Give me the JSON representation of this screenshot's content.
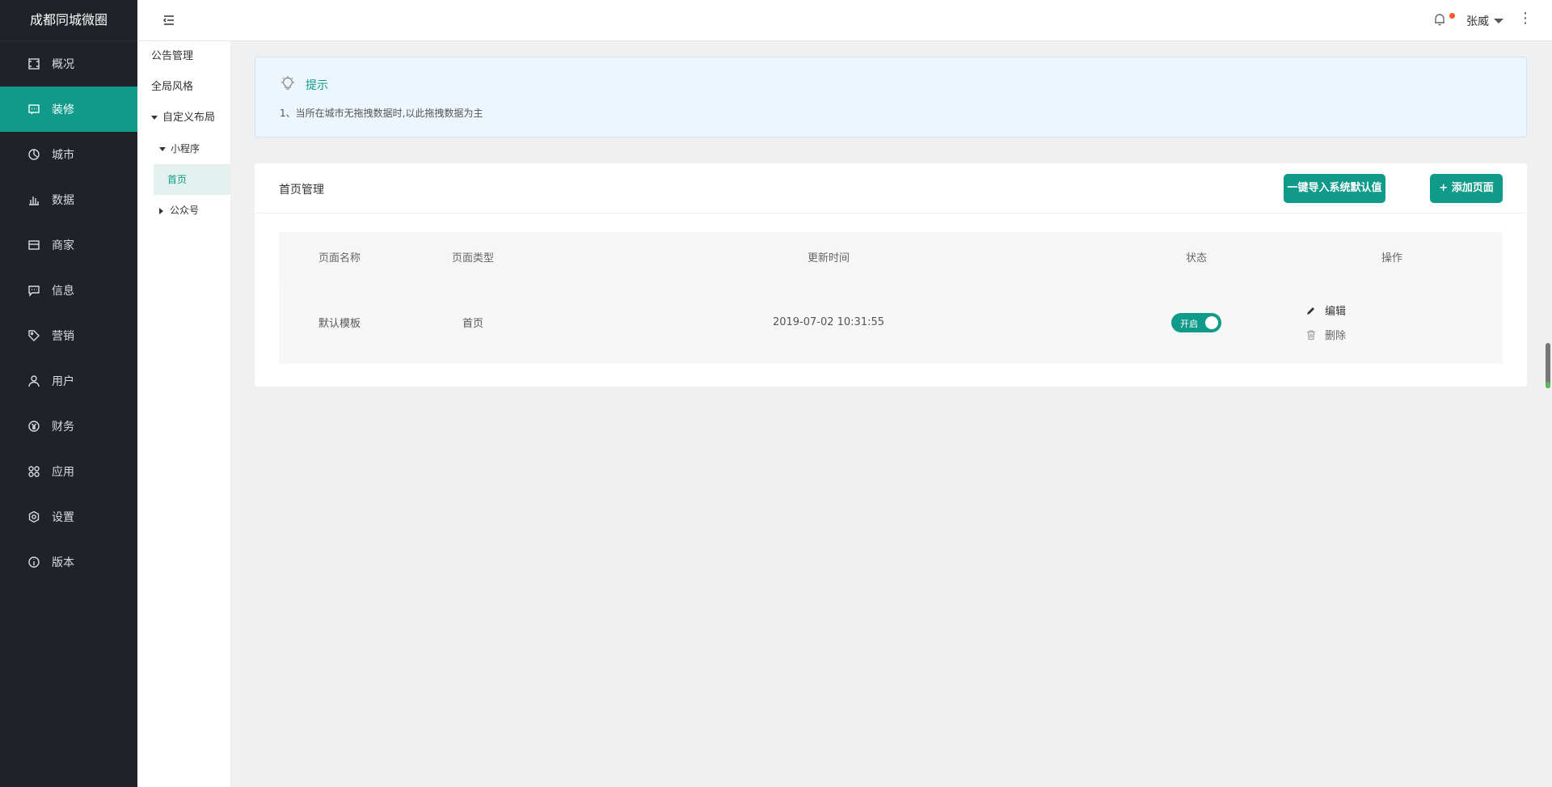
{
  "brand": "成都同城微圈",
  "sidebar": {
    "items": [
      {
        "label": "概况",
        "icon": "overview-icon"
      },
      {
        "label": "装修",
        "icon": "decoration-icon",
        "active": true
      },
      {
        "label": "城市",
        "icon": "city-icon"
      },
      {
        "label": "数据",
        "icon": "data-icon"
      },
      {
        "label": "商家",
        "icon": "merchant-icon"
      },
      {
        "label": "信息",
        "icon": "message-icon"
      },
      {
        "label": "营销",
        "icon": "tag-icon"
      },
      {
        "label": "用户",
        "icon": "user-icon"
      },
      {
        "label": "财务",
        "icon": "finance-icon"
      },
      {
        "label": "应用",
        "icon": "apps-icon"
      },
      {
        "label": "设置",
        "icon": "settings-icon"
      },
      {
        "label": "版本",
        "icon": "info-icon"
      }
    ]
  },
  "topbar": {
    "user_name": "张威",
    "notification_dot_color": "#ff5722"
  },
  "subnav": {
    "announcement": "公告管理",
    "global_style": "全局风格",
    "custom_layout": "自定义布局",
    "mini_program": "小程序",
    "home": "首页",
    "official_account": "公众号"
  },
  "tip": {
    "title": "提示",
    "text": "1、当所在城市无拖拽数据时,以此拖拽数据为主"
  },
  "card": {
    "title": "首页管理",
    "import_button": "一键导入系统默认值",
    "add_button": "+ 添加页面",
    "columns": [
      "页面名称",
      "页面类型",
      "更新时间",
      "状态",
      "操作"
    ],
    "rows": [
      {
        "name": "默认模板",
        "type": "首页",
        "updated": "2019-07-02 10:31:55",
        "status": "开启",
        "edit": "编辑",
        "delete": "删除"
      }
    ]
  },
  "colors": {
    "accent": "#0f9a89",
    "sidebar_bg": "#20222a",
    "tip_bg": "#edf5fd"
  }
}
